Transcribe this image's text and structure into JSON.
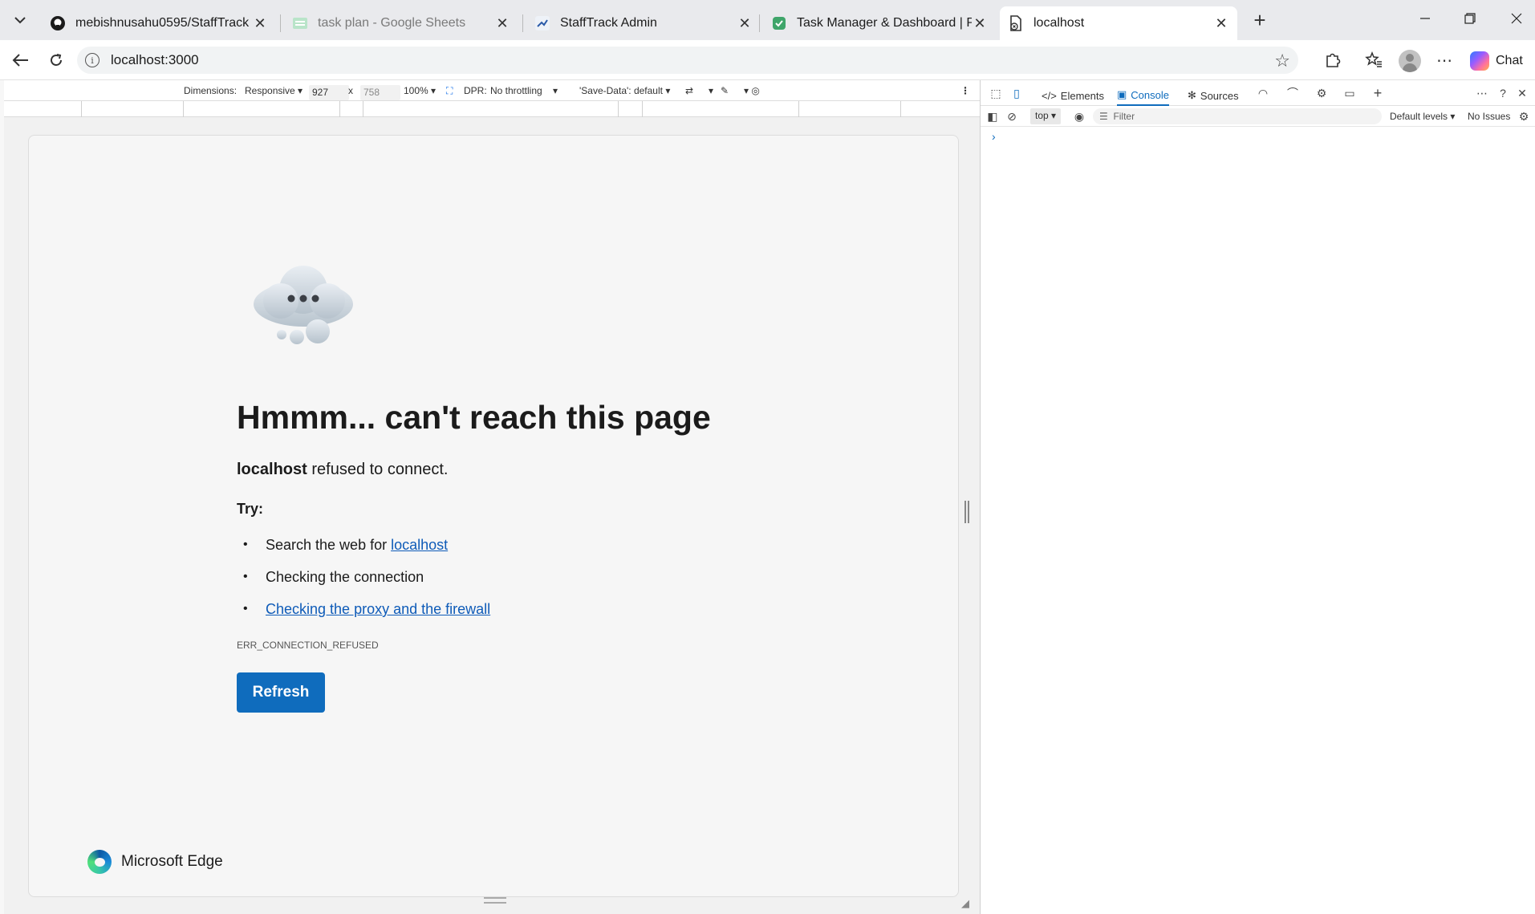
{
  "tabs": [
    {
      "title": "mebishnusahu0595/StaffTrack",
      "icon": "github-icon",
      "active": false
    },
    {
      "title": "task plan - Google Sheets",
      "icon": "sheets-icon",
      "active": false
    },
    {
      "title": "StaffTrack Admin",
      "icon": "stafftrack-icon",
      "active": false
    },
    {
      "title": "Task Manager & Dashboard | Petp",
      "icon": "task-manager-icon",
      "active": false
    },
    {
      "title": "localhost",
      "icon": "broken-page-icon",
      "active": true
    }
  ],
  "address_bar": {
    "url": "localhost:3000"
  },
  "toolbar": {
    "chat_label": "Chat"
  },
  "device_toolbar": {
    "dimensions_label": "Dimensions:",
    "mode": "Responsive",
    "width": "927",
    "x_sep": "x",
    "height": "758",
    "zoom": "100%",
    "dpr_label": "DPR:",
    "throttling": "No throttling",
    "save_data": "'Save-Data': default"
  },
  "error_page": {
    "title": "Hmmm... can't reach this page",
    "host": "localhost",
    "message": " refused to connect.",
    "try_label": "Try:",
    "suggestion1_text": "Search the web for ",
    "suggestion1_link": "localhost",
    "suggestion2": "Checking the connection",
    "suggestion3_link": "Checking the proxy and the firewall",
    "error_code": "ERR_CONNECTION_REFUSED",
    "refresh_label": "Refresh",
    "brand": "Microsoft Edge"
  },
  "devtools": {
    "tabs": {
      "elements": "Elements",
      "console": "Console",
      "sources": "Sources"
    },
    "active_tab": "Console",
    "context": "top",
    "filter_placeholder": "Filter",
    "levels": "Default levels",
    "issues": "No Issues",
    "prompt": "›"
  },
  "colors": {
    "accent": "#0f6cbd",
    "link": "#0e5bb8",
    "tabstrip": "#e9eaed"
  }
}
